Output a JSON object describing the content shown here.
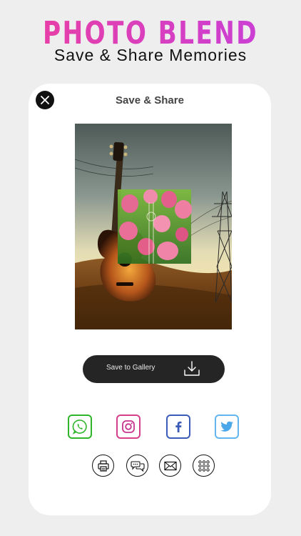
{
  "header": {
    "title": "PHOTO BLEND",
    "subtitle": "Save & Share Memories"
  },
  "dialog": {
    "title": "Save & Share",
    "close_icon": "close-icon",
    "image": "blended photo of acoustic guitar on hillside with pink tulips overlay and power pylon"
  },
  "actions": {
    "save_label": "Save to Gallery",
    "save_icon": "download-icon"
  },
  "share": [
    {
      "name": "whatsapp",
      "icon": "whatsapp-icon",
      "color": "#2fb52a"
    },
    {
      "name": "instagram",
      "icon": "instagram-icon",
      "color": "#d63d8a"
    },
    {
      "name": "facebook",
      "icon": "facebook-icon",
      "color": "#3b5bb8"
    },
    {
      "name": "twitter",
      "icon": "twitter-icon",
      "color": "#62b6f0"
    }
  ],
  "tools": [
    {
      "name": "print",
      "icon": "printer-icon"
    },
    {
      "name": "message",
      "icon": "chat-icon"
    },
    {
      "name": "mail",
      "icon": "mail-icon"
    },
    {
      "name": "more",
      "icon": "grid-dots-icon"
    }
  ],
  "colors": {
    "title_gradient_start": "#e83fa6",
    "title_gradient_end": "#c93fd6",
    "save_button_bg": "#252525",
    "background": "#eeeeee"
  }
}
